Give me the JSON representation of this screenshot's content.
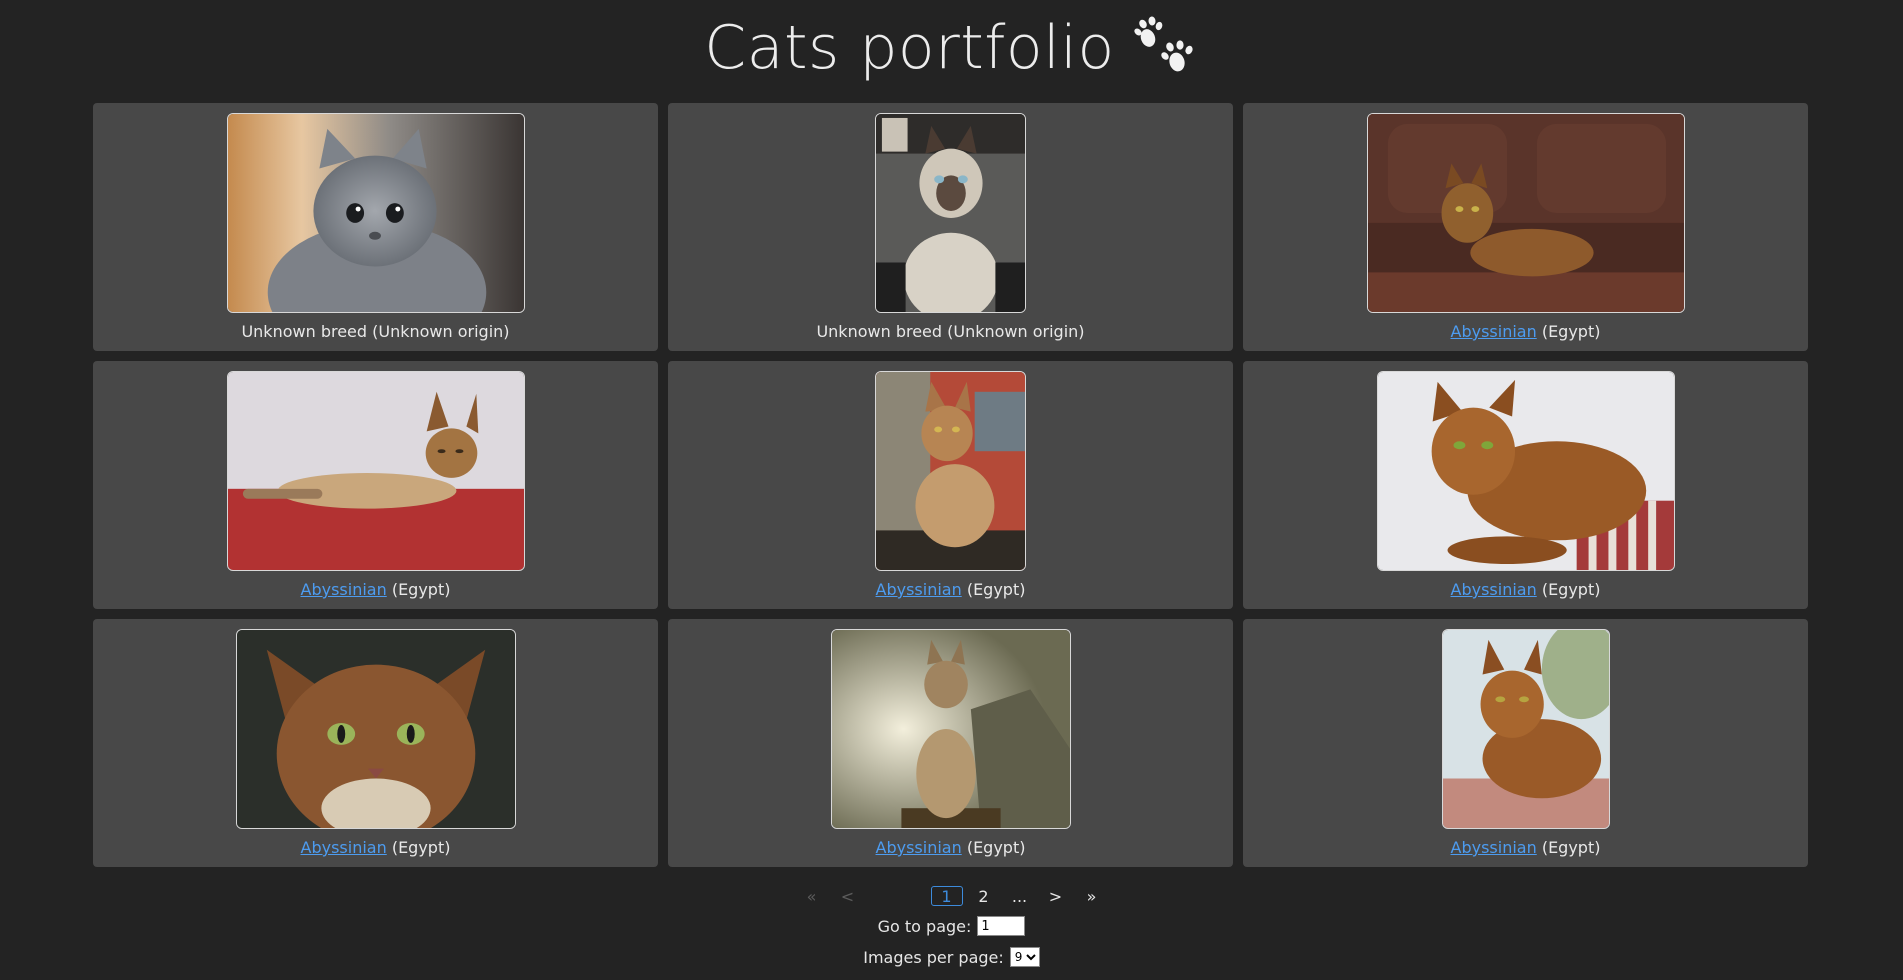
{
  "header": {
    "title": "Cats portfolio",
    "icon": "paw-prints-icon"
  },
  "cards": [
    {
      "breed": "Unknown breed",
      "origin": "(Unknown origin)",
      "linked": false,
      "photo": "gray-kitten"
    },
    {
      "breed": "Unknown breed",
      "origin": "(Unknown origin)",
      "linked": false,
      "photo": "siamese-cat"
    },
    {
      "breed": "Abyssinian",
      "origin": "(Egypt)",
      "linked": true,
      "photo": "abyssinian-on-brown-sofa"
    },
    {
      "breed": "Abyssinian",
      "origin": "(Egypt)",
      "linked": true,
      "photo": "abyssinian-lying-red-surface"
    },
    {
      "breed": "Abyssinian",
      "origin": "(Egypt)",
      "linked": true,
      "photo": "abyssinian-sitting-brick-wall"
    },
    {
      "breed": "Abyssinian",
      "origin": "(Egypt)",
      "linked": true,
      "photo": "abyssinian-on-striped-cushion"
    },
    {
      "breed": "Abyssinian",
      "origin": "(Egypt)",
      "linked": true,
      "photo": "abyssinian-face-closeup"
    },
    {
      "breed": "Abyssinian",
      "origin": "(Egypt)",
      "linked": true,
      "photo": "abyssinian-sitting-backlit"
    },
    {
      "breed": "Abyssinian",
      "origin": "(Egypt)",
      "linked": true,
      "photo": "abyssinian-lying-outdoors"
    }
  ],
  "pagination": {
    "first": "«",
    "prev": "<",
    "current": "1",
    "next_page": "2",
    "ellipsis": "...",
    "next": ">",
    "last": "»"
  },
  "goto": {
    "label": "Go to page:",
    "value": "1"
  },
  "per_page": {
    "label": "Images per page:",
    "selected": "9"
  },
  "colors": {
    "background": "#232323",
    "card": "#484848",
    "link": "#4d9cf0",
    "active_page": "#3d8bdc"
  }
}
